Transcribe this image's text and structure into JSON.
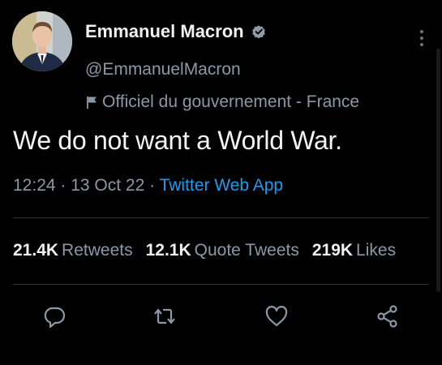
{
  "tweet": {
    "author_name": "Emmanuel Macron",
    "handle": "@EmmanuelMacron",
    "gov_label": "Officiel du gouvernement - France",
    "text": "We do not want a World War.",
    "time": "12:24",
    "date": "13 Oct 22",
    "source": "Twitter Web App",
    "separator": " · "
  },
  "stats": [
    {
      "value": "21.4K",
      "label": "Retweets"
    },
    {
      "value": "12.1K",
      "label": "Quote Tweets"
    },
    {
      "value": "219K",
      "label": "Likes"
    }
  ],
  "icons": {
    "verified": "verified-badge-icon",
    "gov": "flag-icon",
    "more": "more-options-icon",
    "reply": "reply-icon",
    "retweet": "retweet-icon",
    "like": "like-icon",
    "share": "share-icon"
  },
  "colors": {
    "background": "#000000",
    "text_primary": "#e7e9ea",
    "text_secondary": "#8b98a5",
    "accent": "#1d9bf0",
    "divider": "#2f3336"
  }
}
